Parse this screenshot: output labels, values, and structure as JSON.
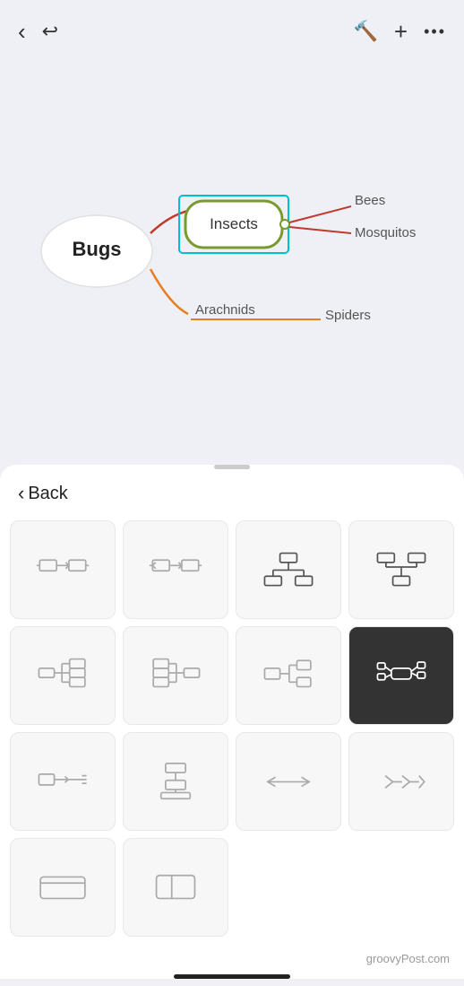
{
  "header": {
    "back_label": "‹",
    "undo_label": "↺",
    "hammer_icon": "🔨",
    "plus_label": "+",
    "more_label": "···"
  },
  "mindmap": {
    "center_node": "Bugs",
    "insects_node": "Insects",
    "branches": [
      {
        "label": "Bees",
        "color": "#c0392b"
      },
      {
        "label": "Mosquitos",
        "color": "#c0392b"
      },
      {
        "label": "Arachnids",
        "color": "#e67e22"
      },
      {
        "label": "Spiders",
        "color": "#e67e22"
      }
    ]
  },
  "panel": {
    "back_label": "Back",
    "shapes": [
      {
        "id": "shape-1",
        "active": false
      },
      {
        "id": "shape-2",
        "active": false
      },
      {
        "id": "shape-3",
        "active": false
      },
      {
        "id": "shape-4",
        "active": false
      },
      {
        "id": "shape-5",
        "active": false
      },
      {
        "id": "shape-6",
        "active": false
      },
      {
        "id": "shape-7",
        "active": false
      },
      {
        "id": "shape-8",
        "active": true
      },
      {
        "id": "shape-9",
        "active": false
      },
      {
        "id": "shape-10",
        "active": false
      },
      {
        "id": "shape-11",
        "active": false
      },
      {
        "id": "shape-12",
        "active": false
      },
      {
        "id": "shape-13",
        "active": false
      },
      {
        "id": "shape-14",
        "active": false
      }
    ]
  },
  "watermark": {
    "text": "groovyPost.com"
  }
}
